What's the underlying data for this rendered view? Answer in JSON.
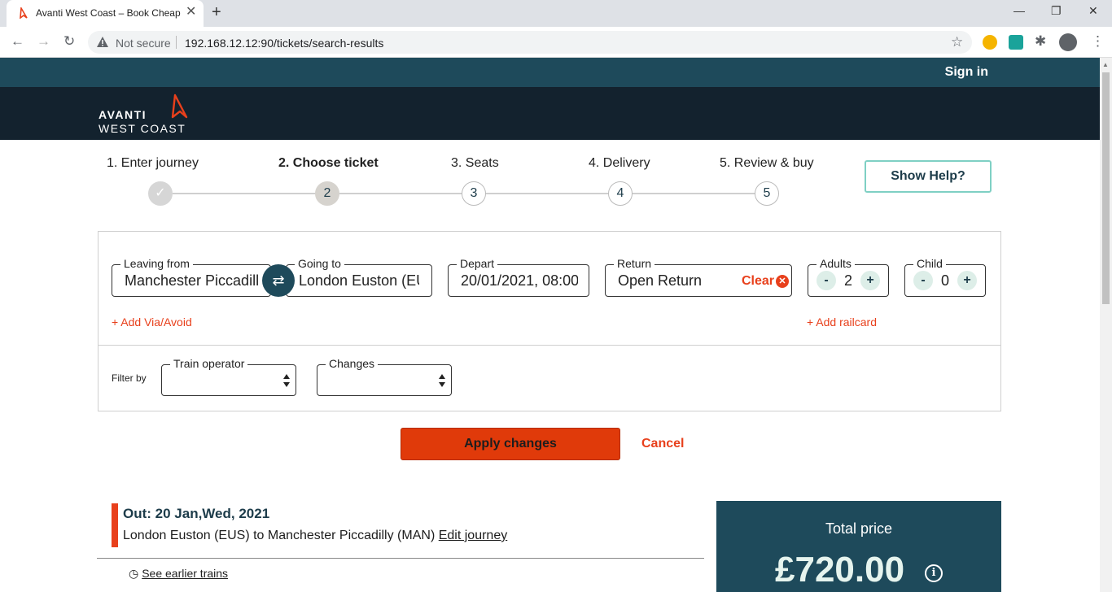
{
  "browser": {
    "tab_title": "Avanti West Coast – Book Cheap",
    "security_label": "Not secure",
    "url": "192.168.12.12:90/tickets/search-results"
  },
  "site": {
    "signin": "Sign in",
    "logo_line1": "AVANTI",
    "logo_line2": "WEST COAST"
  },
  "steps": [
    {
      "label": "1. Enter journey",
      "marker": "✓",
      "state": "done"
    },
    {
      "label": "2. Choose ticket",
      "marker": "2",
      "state": "current"
    },
    {
      "label": "3. Seats",
      "marker": "3",
      "state": "todo"
    },
    {
      "label": "4. Delivery",
      "marker": "4",
      "state": "todo"
    },
    {
      "label": "5. Review & buy",
      "marker": "5",
      "state": "todo"
    }
  ],
  "help_button": "Show Help?",
  "search": {
    "leaving_label": "Leaving from",
    "leaving_value": "Manchester Piccadill",
    "going_label": "Going to",
    "going_value": "London Euston (EUS)",
    "depart_label": "Depart",
    "depart_value": "20/01/2021, 08:00",
    "return_label": "Return",
    "return_value": "Open Return",
    "clear_label": "Clear",
    "adults_label": "Adults",
    "adults_value": "2",
    "child_label": "Child",
    "child_value": "0",
    "minus": "-",
    "plus": "+",
    "add_via": "+ Add Via/Avoid",
    "add_railcard": "+ Add railcard"
  },
  "filters": {
    "label": "Filter by",
    "operator_label": "Train operator",
    "changes_label": "Changes"
  },
  "actions": {
    "apply": "Apply changes",
    "cancel": "Cancel"
  },
  "journey": {
    "out_title": "Out: 20 Jan,Wed, 2021",
    "route": "London Euston (EUS) to Manchester Piccadilly (MAN)",
    "edit": "Edit journey",
    "earlier": "See earlier trains"
  },
  "price": {
    "label": "Total price",
    "value": "£720.00"
  },
  "colors": {
    "brand_teal": "#1e4a5b",
    "brand_navy": "#13222e",
    "accent_orange": "#e8401c",
    "help_border": "#7fd0c4"
  }
}
